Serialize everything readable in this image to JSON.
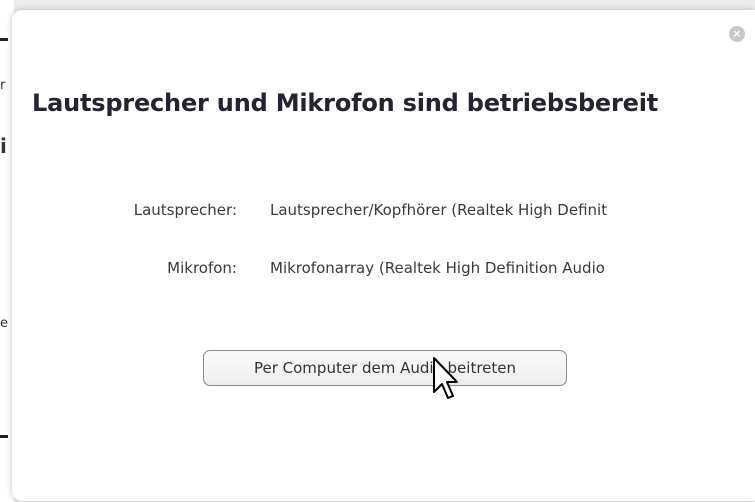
{
  "dialog": {
    "title": "Lautsprecher und Mikrofon sind betriebsbereit",
    "close_icon": "close-icon",
    "speaker": {
      "label": "Lautsprecher:",
      "value": "Lautsprecher/Kopfhörer (Realtek High Definit"
    },
    "microphone": {
      "label": "Mikrofon:",
      "value": "Mikrofonarray (Realtek High Definition Audio"
    },
    "join_button_label": "Per Computer dem Audio beitreten",
    "close_symbol": "×"
  },
  "background": {
    "fragments": [
      "r",
      "i",
      "e"
    ]
  },
  "colors": {
    "title": "#232333",
    "close_button": "#c8c8c8",
    "button_border": "#8a8a8a"
  }
}
